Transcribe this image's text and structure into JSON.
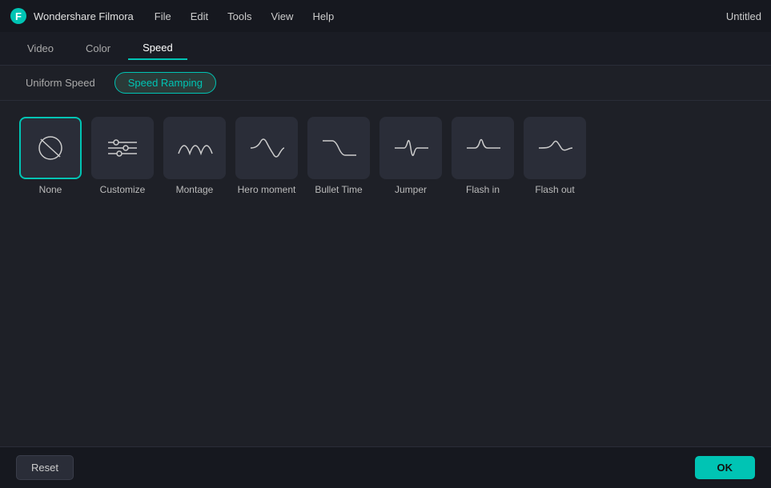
{
  "titlebar": {
    "appname": "Wondershare Filmora",
    "menu": [
      "File",
      "Edit",
      "Tools",
      "View",
      "Help"
    ],
    "title": "Untitled"
  },
  "tabs": {
    "items": [
      "Video",
      "Color",
      "Speed"
    ],
    "active": "Speed"
  },
  "subtabs": {
    "items": [
      "Uniform Speed",
      "Speed Ramping"
    ],
    "active": "Speed Ramping"
  },
  "speed_cards": [
    {
      "id": "none",
      "label": "None",
      "selected": true
    },
    {
      "id": "customize",
      "label": "Customize",
      "selected": false
    },
    {
      "id": "montage",
      "label": "Montage",
      "selected": false
    },
    {
      "id": "hero-moment",
      "label": "Hero\nmoment",
      "selected": false
    },
    {
      "id": "bullet-time",
      "label": "Bullet\nTime",
      "selected": false
    },
    {
      "id": "jumper",
      "label": "Jumper",
      "selected": false
    },
    {
      "id": "flash-in",
      "label": "Flash in",
      "selected": false
    },
    {
      "id": "flash-out",
      "label": "Flash out",
      "selected": false
    }
  ],
  "buttons": {
    "reset": "Reset",
    "ok": "OK"
  }
}
